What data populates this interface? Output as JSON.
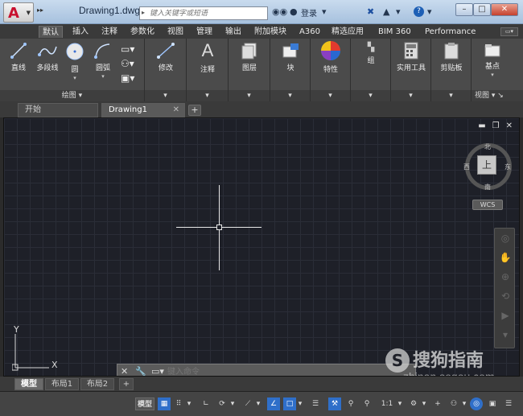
{
  "titlebar": {
    "document_title": "Drawing1.dwg",
    "search_placeholder": "键入关键字或短语",
    "login_label": "登录",
    "help_label": "?",
    "minimize": "–",
    "maximize": "□",
    "close": "✕"
  },
  "ribbon_tabs": [
    "默认",
    "插入",
    "注释",
    "参数化",
    "视图",
    "管理",
    "输出",
    "附加模块",
    "A360",
    "精选应用",
    "BIM 360",
    "Performance"
  ],
  "ribbon_tab_active": "默认",
  "ribbon": {
    "draw_panel_label": "绘图",
    "line": "直线",
    "polyline": "多段线",
    "circle": "圆",
    "arc": "圆弧",
    "modify": "修改",
    "annotation": "注释",
    "layers": "图层",
    "block": "块",
    "properties": "特性",
    "groups": "组",
    "utilities": "实用工具",
    "clipboard": "剪贴板",
    "base": "基点",
    "view_panel_label": "视图"
  },
  "doc_tabs": {
    "start": "开始",
    "drawing": "Drawing1",
    "close": "✕",
    "add": "+"
  },
  "viewcube": {
    "top": "上",
    "north": "北",
    "south": "南",
    "east": "东",
    "west": "西",
    "wcs": "WCS"
  },
  "ucs": {
    "x": "X",
    "y": "Y"
  },
  "command_line": {
    "placeholder": "键入命令"
  },
  "watermark": {
    "name": "搜狗指南",
    "url": "zhinan.sogou.com"
  },
  "layout_tabs": [
    "模型",
    "布局1",
    "布局2"
  ],
  "layout_tab_active": "模型",
  "layout_add": "+",
  "status": {
    "model": "模型",
    "scale": "1:1"
  }
}
